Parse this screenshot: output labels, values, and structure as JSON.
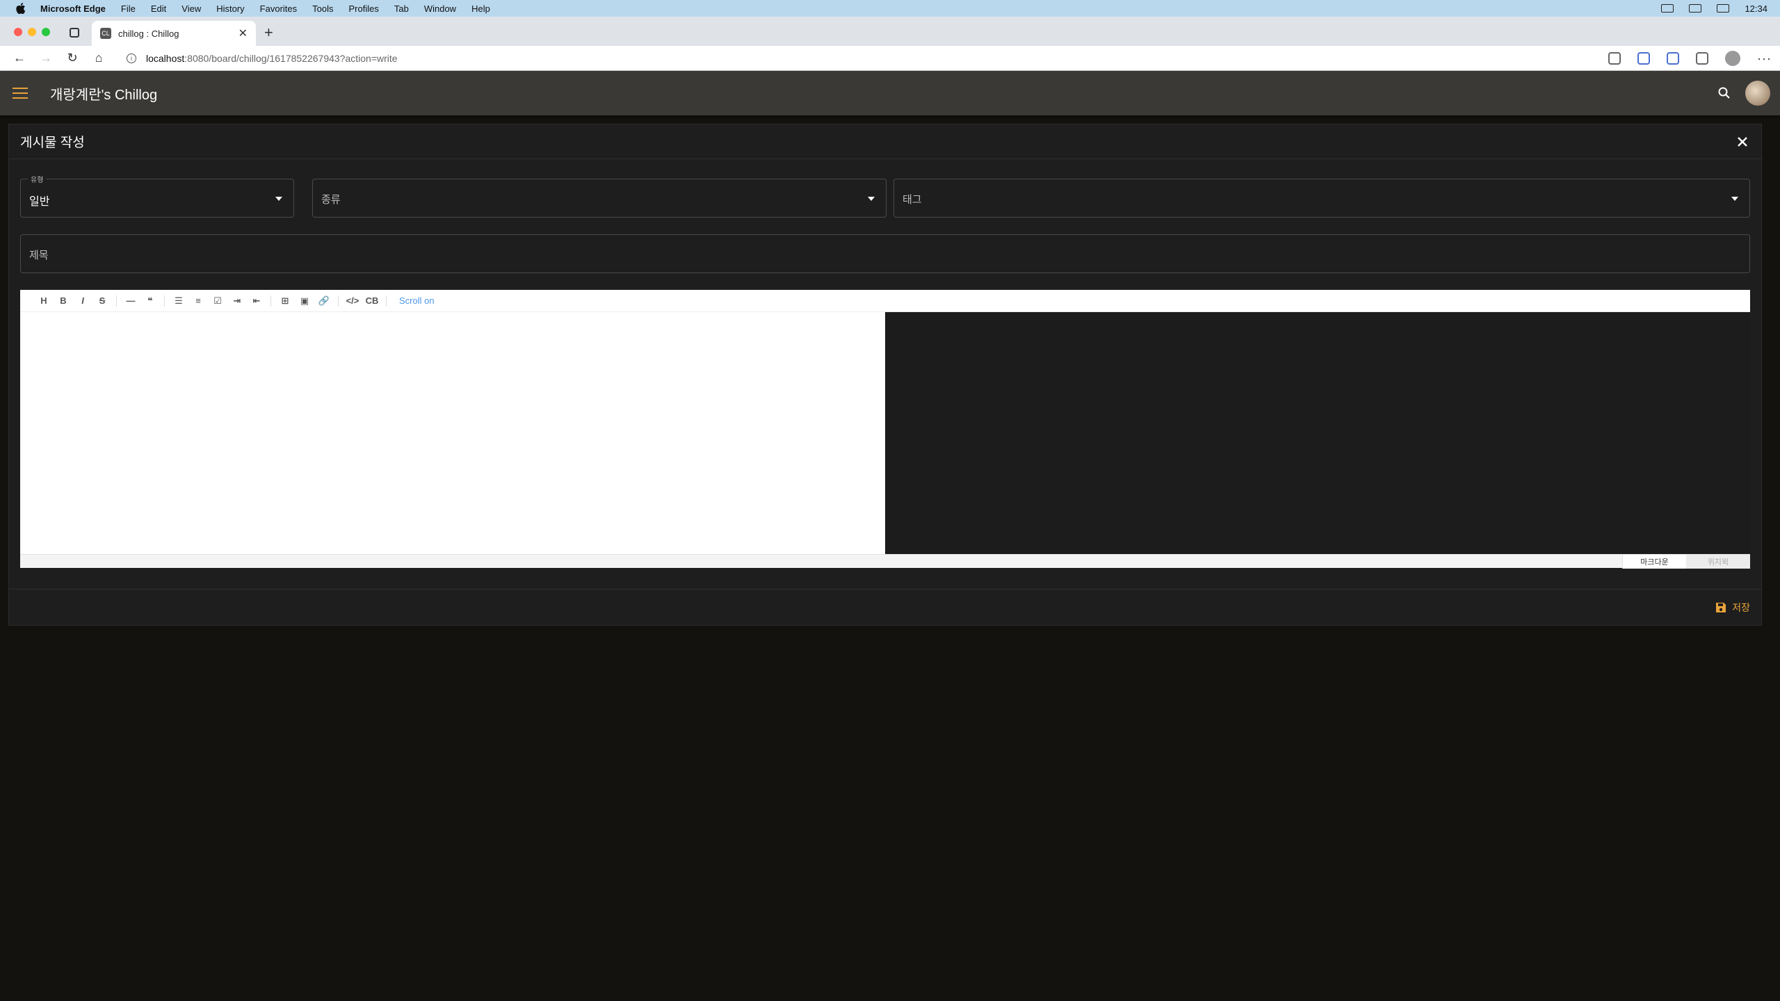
{
  "menubar": {
    "items": [
      "Microsoft Edge",
      "File",
      "Edit",
      "View",
      "History",
      "Favorites",
      "Tools",
      "Profiles",
      "Tab",
      "Window",
      "Help"
    ],
    "clock": "12:34"
  },
  "tab": {
    "favicon": "CL",
    "title": "chillog : Chillog"
  },
  "address": {
    "host": "localhost",
    "path": ":8080/board/chillog/1617852267943?action=write"
  },
  "appbar": {
    "title": "개랑계란's Chillog"
  },
  "dialog": {
    "title": "게시물 작성",
    "type_label": "유형",
    "type_value": "일반",
    "kind_placeholder": "종류",
    "tag_placeholder": "태그",
    "subject_placeholder": "제목"
  },
  "editor": {
    "toolbar": [
      "H",
      "B",
      "I",
      "S",
      "—",
      "❝",
      "☰",
      "≡",
      "☑",
      "⇥",
      "⇤",
      "⊞",
      "▣",
      "🔗",
      "</>",
      "CB"
    ],
    "scroll_toggle": "Scroll on",
    "mode_markdown": "마크다운",
    "mode_wysiwyg": "위지윅"
  },
  "footer": {
    "save_label": "저장"
  },
  "colors": {
    "accent": "#e8a33a",
    "appbar": "#3a3936",
    "card": "#1e1e1e",
    "page": "#14120f"
  }
}
